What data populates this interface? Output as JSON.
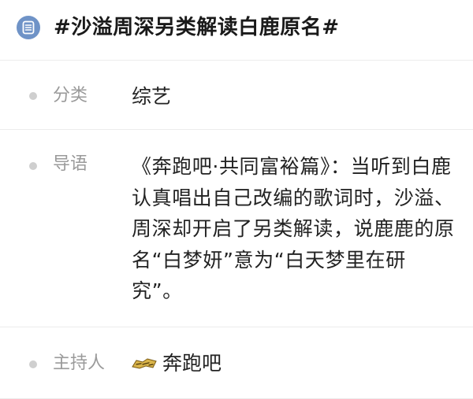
{
  "header": {
    "icon": "document-list-icon",
    "title": "#沙溢周深另类解读白鹿原名#"
  },
  "details": {
    "category": {
      "label": "分类",
      "value": "综艺"
    },
    "intro": {
      "label": "导语",
      "value": "《奔跑吧·共同富裕篇》：当听到白鹿认真唱出自己改编的歌词时，沙溢、周深却开启了另类解读，说鹿鹿的原名“白梦妍”意为“白天梦里在研究”。"
    },
    "host": {
      "label": "主持人",
      "logo": "show-logo-icon",
      "value": "奔跑吧"
    }
  },
  "colors": {
    "accent_icon": "#6f93c7",
    "label_gray": "#9a9a9a",
    "divider": "#ececec",
    "dot_gray": "#cfcfcf"
  }
}
